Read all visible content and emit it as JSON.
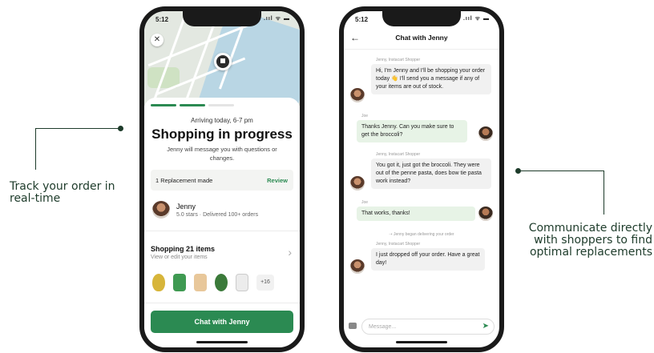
{
  "callouts": {
    "left": "Track your order in real-time",
    "right": "Communicate directly with shoppers to find optimal replacements"
  },
  "phone1": {
    "status_time": "5:12",
    "status_icons": ".ııl ᯤ ▬",
    "close": "✕",
    "arriving": "Arriving today, 6-7 pm",
    "title": "Shopping in progress",
    "subtitle": "Jenny will message you with questions or changes.",
    "replacement_label": "1 Replacement made",
    "replacement_action": "Review",
    "shopper_name": "Jenny",
    "shopper_stats": "5.0 stars · Delivered 100+ orders",
    "items_title": "Shopping 21 items",
    "items_sub": "View or edit your items",
    "items_more": "+16",
    "chat_button": "Chat with Jenny",
    "brand_green": "#2b8a52"
  },
  "phone2": {
    "status_time": "5:12",
    "status_icons": ".ııl ᯤ ▬",
    "back": "←",
    "title": "Chat with Jenny",
    "messages": [
      {
        "meta": "Jenny, Instacart Shopper",
        "text": "Hi, I'm Jenny and I'll be shopping your order today 👋 I'll send you a message if any of your items are out of stock."
      },
      {
        "meta": "Joe",
        "text": "Thanks Jenny. Can you make sure to get the broccoli?"
      },
      {
        "meta": "Jenny, Instacart Shopper",
        "text": "You got it, just got the broccoli. They were out of the penne pasta, does bow tie pasta work instead?"
      },
      {
        "meta": "Joe",
        "text": "That works, thanks!"
      },
      {
        "meta": "Jenny, Instacart Shopper",
        "text": "I just dropped off your order. Have a great day!"
      }
    ],
    "system": "Jenny began delivering your order",
    "composer_placeholder": "Message...",
    "send": "➤"
  }
}
